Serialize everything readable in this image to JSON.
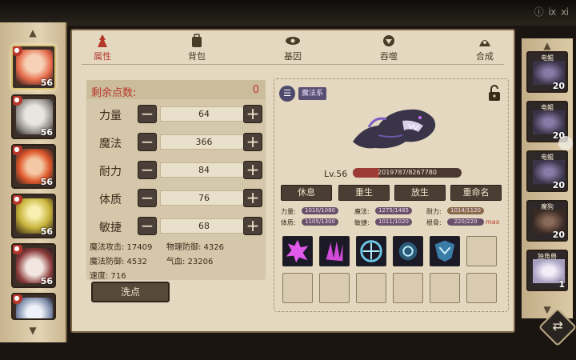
{
  "top_bar": {
    "text": "ⓘ ⅸ ⅺ"
  },
  "tabs": [
    {
      "label": "属性",
      "icon": "attribute-icon",
      "active": true
    },
    {
      "label": "背包",
      "icon": "backpack-icon",
      "active": false
    },
    {
      "label": "基因",
      "icon": "gene-icon",
      "active": false
    },
    {
      "label": "吞噬",
      "icon": "devour-icon",
      "active": false
    },
    {
      "label": "合成",
      "icon": "synthesis-icon",
      "active": false
    }
  ],
  "characters": [
    {
      "level": "56"
    },
    {
      "level": "56"
    },
    {
      "level": "56"
    },
    {
      "level": "56"
    },
    {
      "level": "56"
    },
    {
      "level": ""
    }
  ],
  "stats": {
    "remaining_label": "剩余点数:",
    "remaining_value": "0",
    "rows": [
      {
        "name": "力量",
        "value": "64"
      },
      {
        "name": "魔法",
        "value": "366"
      },
      {
        "name": "耐力",
        "value": "84"
      },
      {
        "name": "体质",
        "value": "76"
      },
      {
        "name": "敏捷",
        "value": "68"
      }
    ],
    "minus": "−",
    "plus": "+",
    "derived": [
      "魔法攻击: 17409",
      "物理防御: 4326",
      "魔法防御: 4532",
      "气血: 23206",
      "速度: 716"
    ],
    "wash_label": "洗点"
  },
  "pet": {
    "type_tag": "魔法系",
    "level_text": "Lv.56",
    "exp_text": "2019787/8267780",
    "exp_fraction": 0.244,
    "actions": [
      "休息",
      "重生",
      "放生",
      "重命名"
    ],
    "attrs": [
      {
        "name": "力量:",
        "value": "1010/1080"
      },
      {
        "name": "魔法:",
        "value": "1275/1485"
      },
      {
        "name": "耐力:",
        "value": "1014/1120"
      },
      {
        "name": "体质:",
        "value": "1105/1300"
      },
      {
        "name": "敏捷:",
        "value": "1011/1020"
      },
      {
        "name": "根骨:",
        "value": "220/220"
      }
    ],
    "max_label": "max"
  },
  "pets": [
    {
      "name": "电鲲",
      "level": "20"
    },
    {
      "name": "电鲲",
      "level": "20"
    },
    {
      "name": "电鲲",
      "level": "20"
    },
    {
      "name": "魔狗",
      "level": "20"
    },
    {
      "name": "独角兽",
      "level": "1"
    }
  ],
  "colors": {
    "accent_red": "#b8372a",
    "panel": "#e4d8c0",
    "button_dark": "#4a3e34"
  }
}
